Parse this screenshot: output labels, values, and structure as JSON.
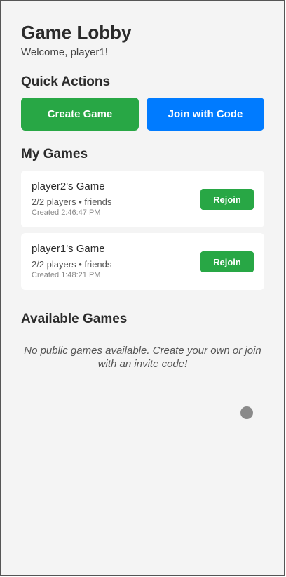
{
  "header": {
    "title": "Game Lobby",
    "welcome": "Welcome, player1!"
  },
  "quick_actions": {
    "title": "Quick Actions",
    "create_label": "Create Game",
    "join_label": "Join with Code"
  },
  "my_games": {
    "title": "My Games",
    "items": [
      {
        "name": "player2's Game",
        "details": "2/2 players • friends",
        "created": "Created 2:46:47 PM",
        "action": "Rejoin"
      },
      {
        "name": "player1's Game",
        "details": "2/2 players • friends",
        "created": "Created 1:48:21 PM",
        "action": "Rejoin"
      }
    ]
  },
  "available_games": {
    "title": "Available Games",
    "empty_message": "No public games available. Create your own or join with an invite code!"
  },
  "colors": {
    "primary_green": "#28a745",
    "primary_blue": "#007bff",
    "background": "#f4f4f4",
    "card": "#ffffff",
    "indicator_dot": "#8a8a8a"
  }
}
